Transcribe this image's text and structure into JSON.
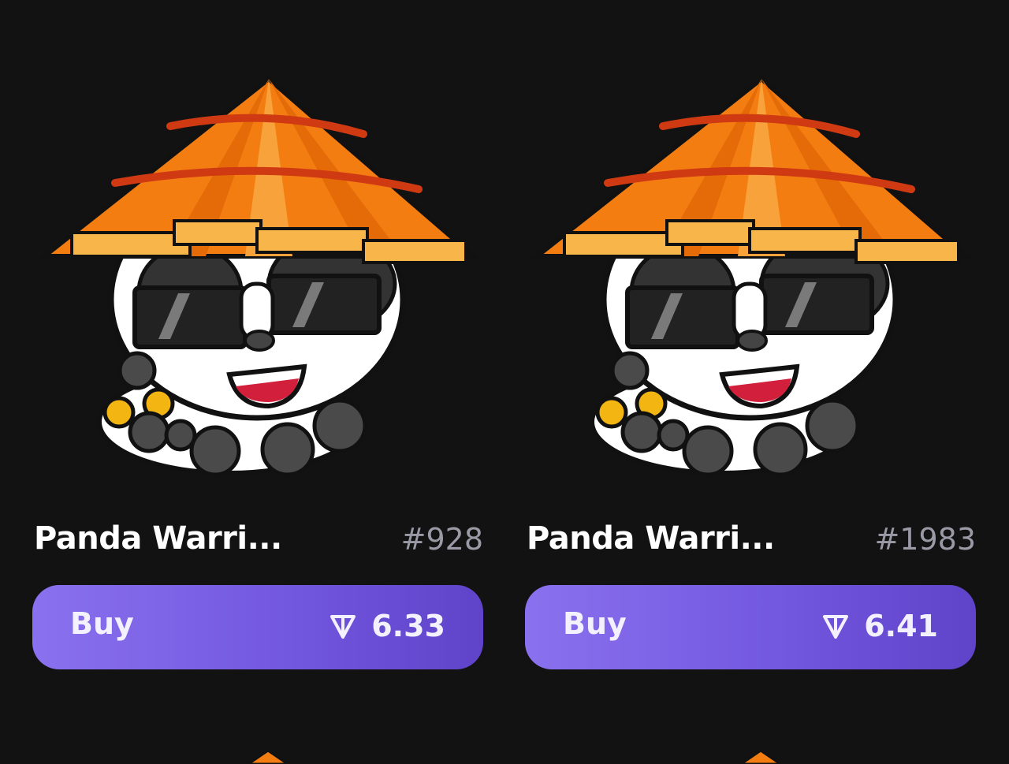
{
  "items": [
    {
      "name": "Panda Warri...",
      "number": "#928",
      "buy_label": "Buy",
      "price": "6.33",
      "currency_icon": "ton-icon"
    },
    {
      "name": "Panda Warri...",
      "number": "#1983",
      "buy_label": "Buy",
      "price": "6.41",
      "currency_icon": "ton-icon"
    }
  ],
  "colors": {
    "background": "#121212",
    "button_gradient_start": "#8a71ee",
    "button_gradient_end": "#5f43c9",
    "number_text": "#9a9aa6",
    "hat_orange": "#f47d12"
  }
}
